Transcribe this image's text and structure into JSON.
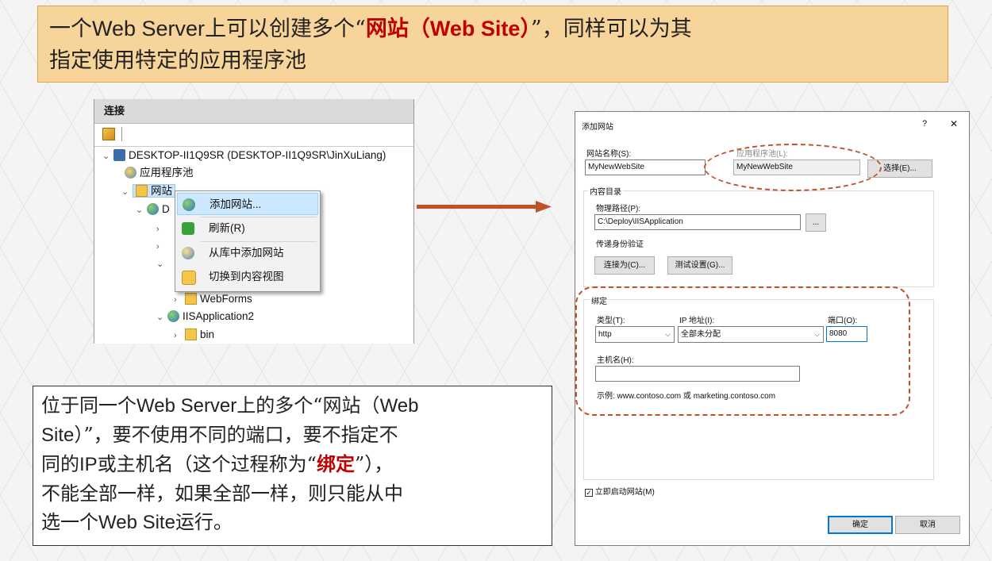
{
  "title": {
    "part1": "一个",
    "ws": "Web Server",
    "part2": "上可以创建多个“",
    "hl_cn": "网站（",
    "hl_en": "Web Site",
    "hl_close": "）",
    "part3": "”，同样可以为其",
    "line2": "指定使用特定的应用程序池"
  },
  "iis": {
    "header": "连接",
    "server_node": "DESKTOP-II1Q9SR (DESKTOP-II1Q9SR\\JinXuLiang)",
    "app_pools": "应用程序池",
    "sites": "网站",
    "site_partial": "D",
    "webforms": "WebForms",
    "iis_app2": "IISApplication2",
    "bin": "bin"
  },
  "context_menu": {
    "items": [
      "添加网站...",
      "刷新(R)",
      "从库中添加网站",
      "切换到内容视图"
    ]
  },
  "note": {
    "l1a": "位于同一个",
    "l1b": "Web Server",
    "l1c": "上的多个“网站（",
    "l1d": "Web",
    "l2a": "Site",
    "l2b": "）”，要不使用不同的端口，要不指定不",
    "l3a": "同的",
    "l3b": "IP",
    "l3c": "或主机名（这个过程称为“",
    "l3hl": "绑定",
    "l3d": "”），",
    "l4": "不能全部一样，如果全部一样，则只能从中",
    "l5a": "选一个",
    "l5b": "Web Site",
    "l5c": "运行。"
  },
  "dialog": {
    "title": "添加网站",
    "help": "?",
    "close": "✕",
    "site_name_label": "网站名称(S):",
    "site_name_value": "MyNewWebSite",
    "app_pool_label": "应用程序池(L):",
    "app_pool_value": "MyNewWebSite",
    "select_button": "选择(E)...",
    "content_dir": "内容目录",
    "physical_path_label": "物理路径(P):",
    "physical_path_value": "C:\\Deploy\\IISApplication",
    "browse_button": "...",
    "passthrough": "传递身份验证",
    "connect_as": "连接为(C)...",
    "test_settings": "测试设置(G)...",
    "binding": "绑定",
    "type_label": "类型(T):",
    "type_value": "http",
    "ip_label": "IP 地址(I):",
    "ip_value": "全部未分配",
    "port_label": "端口(O):",
    "port_value": "8080",
    "host_label": "主机名(H):",
    "host_value": "",
    "example": "示例: www.contoso.com 或 marketing.contoso.com",
    "start_immediately": "立即启动网站(M)",
    "ok": "确定",
    "cancel": "取消"
  },
  "colors": {
    "title_bg": "#f7d49a",
    "highlight_red": "#c00000",
    "arrow": "#c0522a",
    "dash": "#c0522a",
    "accent_blue": "#0078d7"
  }
}
